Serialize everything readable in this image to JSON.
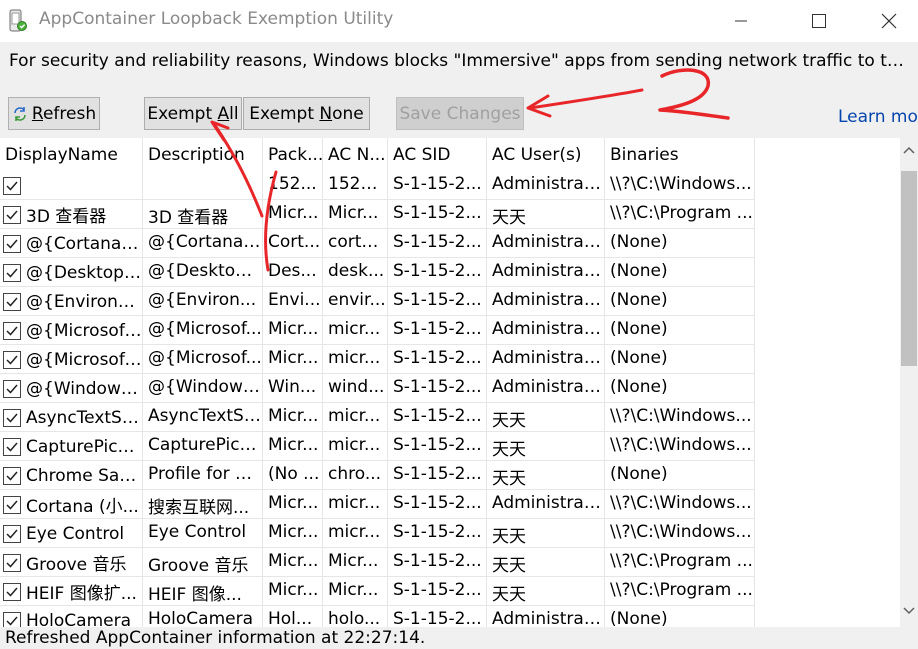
{
  "window": {
    "title": "AppContainer Loopback Exemption Utility"
  },
  "banner": "For security and reliability reasons, Windows blocks \"Immersive\" apps from sending network traffic to the local c...",
  "toolbar": {
    "refresh_label": "Refresh",
    "exempt_all_label": "Exempt All",
    "exempt_none_label": "Exempt None",
    "save_label": "Save Changes",
    "learn_more_label": "Learn mor"
  },
  "table": {
    "headers": [
      "DisplayName",
      "Description",
      "Pack...",
      "AC N...",
      "AC SID",
      "AC User(s)",
      "Binaries"
    ],
    "rows": [
      [
        "",
        "",
        "152...",
        "1527...",
        "S-1-15-2...",
        "Administrat...",
        "\\\\?\\C:\\Windows..."
      ],
      [
        "3D 查看器",
        "3D 查看器",
        "Micr...",
        "Micr...",
        "S-1-15-2...",
        "天天",
        "\\\\?\\C:\\Program ..."
      ],
      [
        "@{CortanaLi...",
        "@{CortanaLi...",
        "Cort...",
        "corta...",
        "S-1-15-2...",
        "Administrat...",
        "(None)"
      ],
      [
        "@{DesktopV...",
        "@{Desktop...",
        "Des...",
        "desk...",
        "S-1-15-2...",
        "Administrat...",
        "(None)"
      ],
      [
        "@{Environm...",
        "@{Environ...",
        "Envi...",
        "envir...",
        "S-1-15-2...",
        "Administrat...",
        "(None)"
      ],
      [
        "@{Microsoft...",
        "@{Microsof...",
        "Micr...",
        "micr...",
        "S-1-15-2...",
        "Administrat...",
        "(None)"
      ],
      [
        "@{Microsoft...",
        "@{Microsof...",
        "Micr...",
        "micr...",
        "S-1-15-2...",
        "Administrat...",
        "(None)"
      ],
      [
        "@{Windows....",
        "@{Windows...",
        "Win...",
        "wind...",
        "S-1-15-2...",
        "Administrat...",
        "(None)"
      ],
      [
        "AsyncTextSe...",
        "AsyncTextSe...",
        "Micr...",
        "micr...",
        "S-1-15-2...",
        "天天",
        "\\\\?\\C:\\Windows..."
      ],
      [
        "CapturePicker",
        "CapturePicker",
        "Micr...",
        "micr...",
        "S-1-15-2...",
        "天天",
        "\\\\?\\C:\\Windows..."
      ],
      [
        "Chrome San...",
        "Profile for C...",
        "(No ...",
        "chro...",
        "S-1-15-2...",
        "天天",
        "(None)"
      ],
      [
        "Cortana (小...",
        "搜索互联网...",
        "Micr...",
        "micr...",
        "S-1-15-2...",
        "Administrat...",
        "\\\\?\\C:\\Windows..."
      ],
      [
        "Eye Control",
        "Eye Control",
        "Micr...",
        "micr...",
        "S-1-15-2...",
        "天天",
        "\\\\?\\C:\\Windows..."
      ],
      [
        "Groove 音乐",
        "Groove 音乐",
        "Micr...",
        "Micr...",
        "S-1-15-2...",
        "天天",
        "\\\\?\\C:\\Program ..."
      ],
      [
        "HEIF 图像扩...",
        "HEIF 图像...",
        "Micr...",
        "Micr...",
        "S-1-15-2...",
        "天天",
        "\\\\?\\C:\\Program ..."
      ],
      [
        "HoloCamera",
        "HoloCamera",
        "Hol...",
        "holo...",
        "S-1-15-2...",
        "Administrat...",
        "(None)"
      ]
    ]
  },
  "status_text": "Refreshed AppContainer information at 22:27:14.",
  "annotation": {
    "number_label": "2",
    "color": "#e8262a"
  }
}
